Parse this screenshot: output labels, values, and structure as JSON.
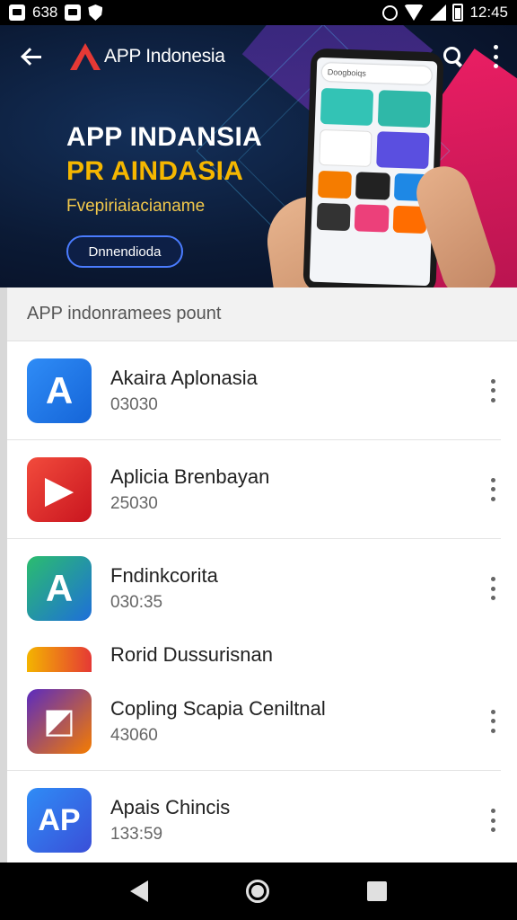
{
  "status_bar": {
    "left_text": "638",
    "time": "12:45"
  },
  "toolbar": {
    "title": "APP Indonesia"
  },
  "banner": {
    "headline_1": "APP INDANSIA",
    "headline_2": "PR AINDASIA",
    "tagline": "Fvepiriaiacianame",
    "cta_label": "Dnnendioda",
    "phone_search_text": "Doogboiqs"
  },
  "section": {
    "title": "APP indonramees pount"
  },
  "apps": [
    {
      "name": "Akaira Aplonasia",
      "sub": "03030",
      "icon_text": "A",
      "colors": [
        "#2f8cf6",
        "#1565d8"
      ]
    },
    {
      "name": "Aplicia Brenbayan",
      "sub": "25030",
      "icon_text": "▶",
      "colors": [
        "#f24b3c",
        "#c9151f"
      ]
    },
    {
      "name": "Fndinkcorita",
      "sub": "030:35",
      "icon_text": "A",
      "colors": [
        "#2bbd6e",
        "#1e6fd9"
      ]
    },
    {
      "name": "Rorid Dussurisnan",
      "sub": "",
      "icon_text": "",
      "colors": [
        "#f4b400",
        "#e53935"
      ]
    },
    {
      "name": "Copling Scapia Ceniltnal",
      "sub": "43060",
      "icon_text": "◩",
      "colors": [
        "#7b2cbf",
        "#f57c00"
      ]
    },
    {
      "name": "Apais Chincis",
      "sub": "133:59",
      "icon_text": "AP",
      "colors": [
        "#2f8cf6",
        "#3a4fd8"
      ]
    }
  ]
}
